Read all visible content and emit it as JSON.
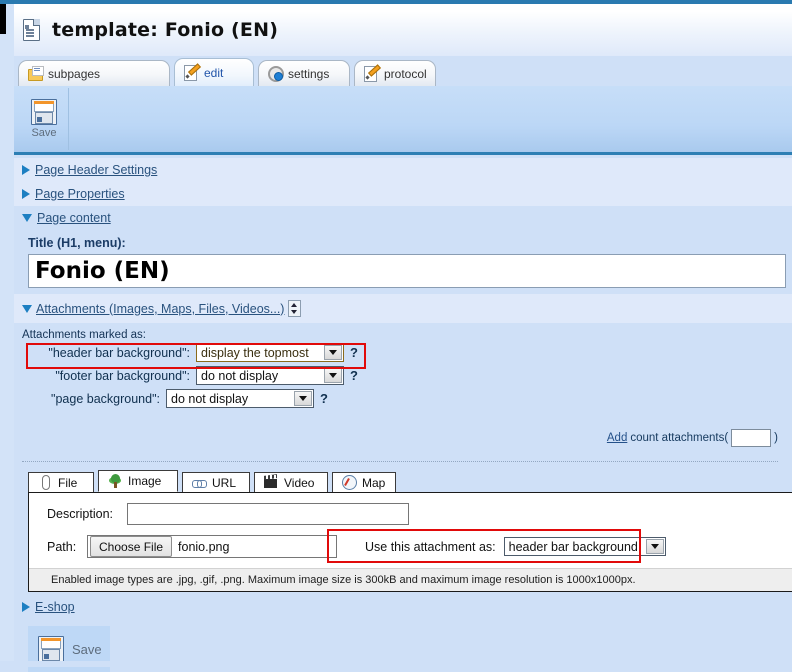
{
  "header": {
    "title": "template: Fonio (EN)",
    "doc_icon": "document-icon"
  },
  "tabs": [
    {
      "label": "subpages",
      "icon": "folder-icon",
      "active": false
    },
    {
      "label": "edit",
      "icon": "pencil-page-icon",
      "active": true
    },
    {
      "label": "settings",
      "icon": "gear-icon",
      "active": false
    },
    {
      "label": "protocol",
      "icon": "pencil-page-icon",
      "active": false
    }
  ],
  "toolbar": {
    "save_label": "Save",
    "save_icon": "floppy-disk-icon"
  },
  "sections": [
    {
      "label": "Page Header Settings",
      "expanded": false
    },
    {
      "label": "Page Properties",
      "expanded": false
    },
    {
      "label": "Page content",
      "expanded": true
    }
  ],
  "content": {
    "title_field_label": "Title (H1, menu):",
    "title_value": "Fonio (EN)"
  },
  "attachments": {
    "header_label": "Attachments (Images, Maps, Files, Videos...)",
    "header_expanded": true,
    "spinner_icon": "updown-spinner-icon",
    "marked_as_label": "Attachments marked as:",
    "rows": [
      {
        "label": "\"header bar background\":",
        "value": "display the topmost",
        "help": "?",
        "highlighted": true
      },
      {
        "label": "\"footer bar background\":",
        "value": "do not display",
        "help": "?",
        "highlighted": false
      },
      {
        "label": "\"page background\":",
        "value": "do not display",
        "help": "?",
        "highlighted": false
      }
    ],
    "add_link": "Add",
    "add_text_before": "count attachments(",
    "add_count_value": "",
    "add_text_after": ")"
  },
  "attachment_panel": {
    "tabs": [
      {
        "label": "File",
        "icon": "paperclip-icon",
        "active": false
      },
      {
        "label": "Image",
        "icon": "tree-image-icon",
        "active": true
      },
      {
        "label": "URL",
        "icon": "link-icon",
        "active": false
      },
      {
        "label": "Video",
        "icon": "film-clapper-icon",
        "active": false
      },
      {
        "label": "Map",
        "icon": "compass-icon",
        "active": false
      }
    ],
    "description_label": "Description:",
    "description_value": "",
    "path_label": "Path:",
    "choose_file_label": "Choose File",
    "file_name": "fonio.png",
    "use_as_label": "Use this attachment as:",
    "use_as_value": "header bar background",
    "note": "Enabled image types are .jpg, .gif, .png. Maximum image size is 300kB and maximum image resolution is 1000x1000px."
  },
  "eshop": {
    "label": "E-shop",
    "expanded": false
  },
  "bottom": {
    "save_label": "Save",
    "save_icon": "floppy-disk-icon"
  },
  "colors": {
    "accent_blue": "#2d7fb4",
    "highlight_red": "#e10a0a",
    "panel_blue": "#cfe0f7",
    "toolbar_blue": "#bcd7f6"
  }
}
